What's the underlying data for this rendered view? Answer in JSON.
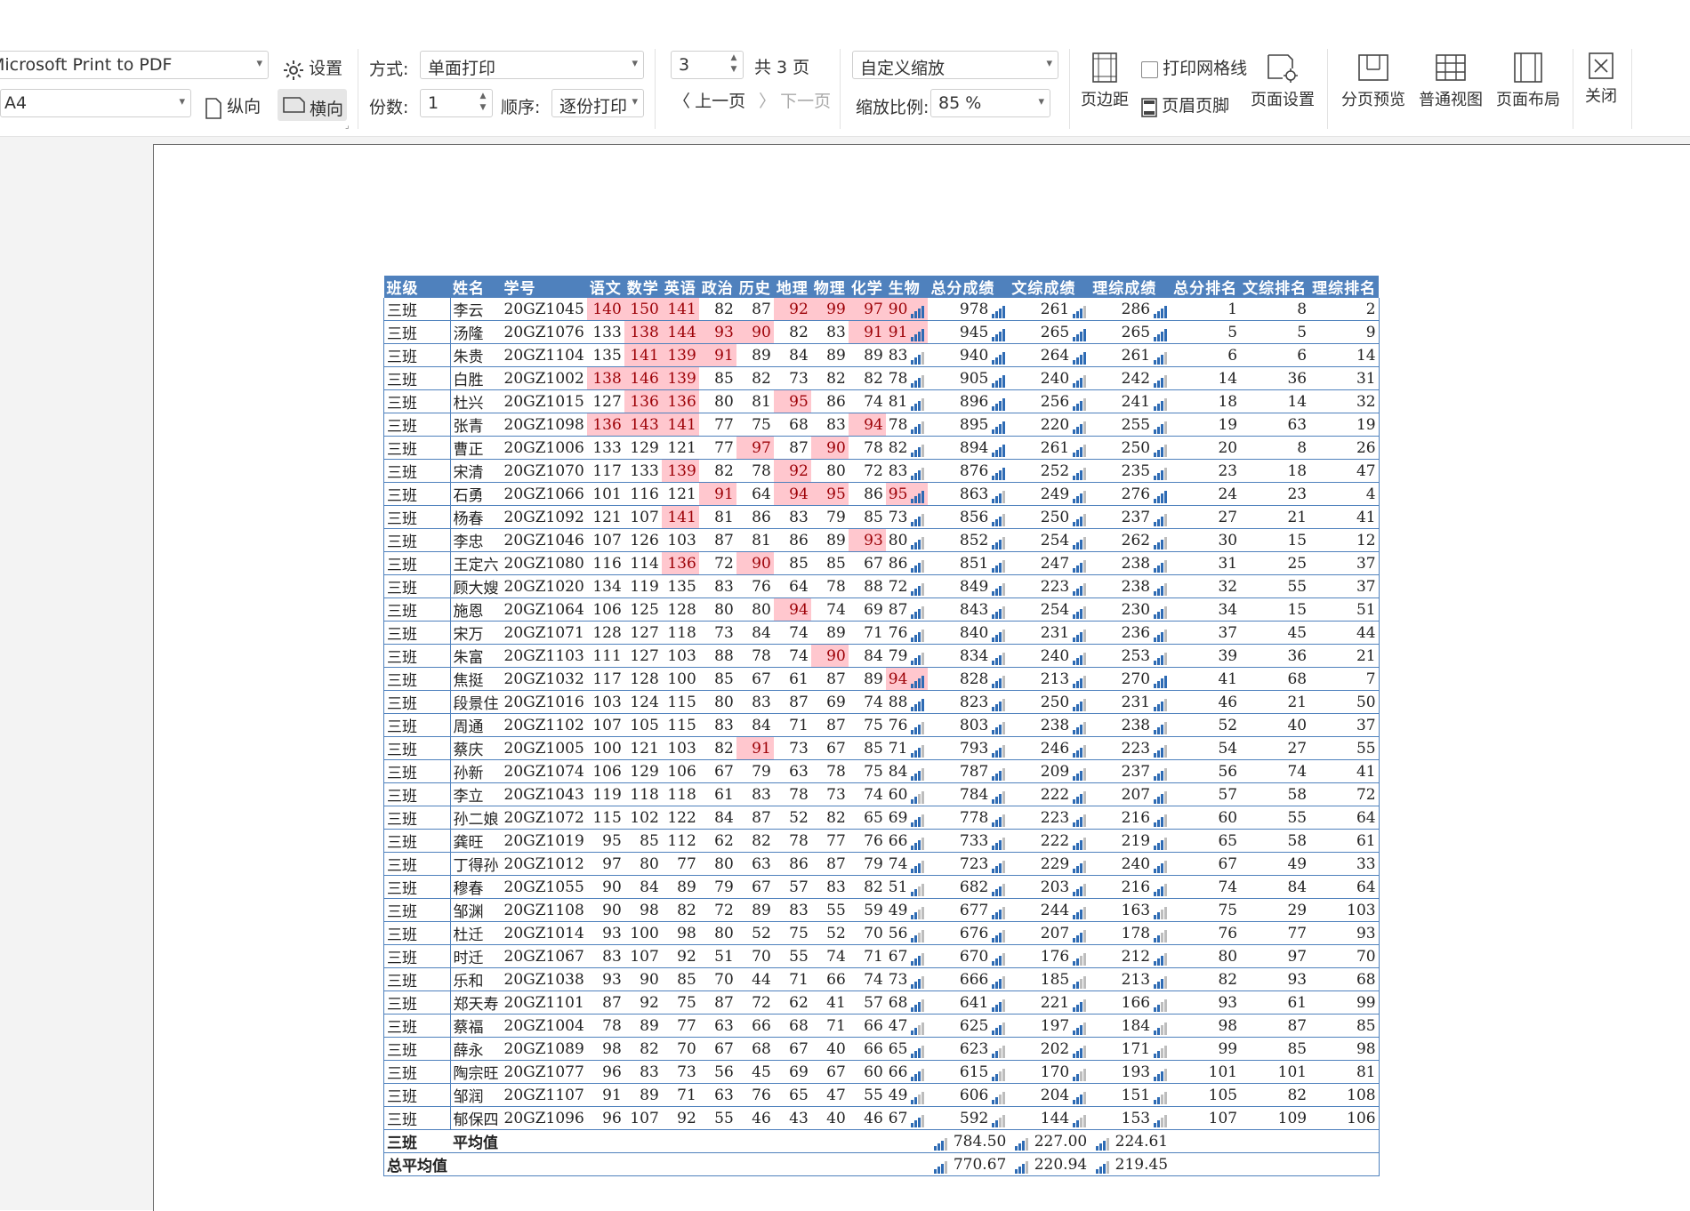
{
  "ribbon": {
    "printer": "Microsoft Print to PDF",
    "settings_label": "设置",
    "paper": "A4",
    "portrait_label": "纵向",
    "landscape_label": "横向",
    "mode_label": "方式:",
    "mode_value": "单面打印",
    "copies_label": "份数:",
    "copies_value": "1",
    "order_label": "顺序:",
    "order_value": "逐份打印",
    "page_value": "3",
    "total_pages": "共 3 页",
    "prev_label": "上一页",
    "next_label": "下一页",
    "zoom_mode": "自定义缩放",
    "zoom_label": "缩放比例:",
    "zoom_value": "85 %",
    "margin_label": "页边距",
    "gridlines_label": "打印网格线",
    "header_footer_label": "页眉页脚",
    "page_setup_label": "页面设置",
    "page_break_label": "分页预览",
    "normal_view_label": "普通视图",
    "page_layout_label": "页面布局",
    "close_label": "关闭"
  },
  "table": {
    "headers": [
      "班级",
      "姓名",
      "学号",
      "语文",
      "数学",
      "英语",
      "政治",
      "历史",
      "地理",
      "物理",
      "化学",
      "生物",
      "总分成绩",
      "文综成绩",
      "理综成绩",
      "总分排名",
      "文综排名",
      "理综排名"
    ],
    "rows": [
      [
        "三班",
        "李云",
        "20GZ1045",
        140,
        150,
        141,
        82,
        87,
        92,
        99,
        97,
        90,
        978,
        261,
        286,
        1,
        8,
        2
      ],
      [
        "三班",
        "汤隆",
        "20GZ1076",
        133,
        138,
        144,
        93,
        90,
        82,
        83,
        91,
        91,
        945,
        265,
        265,
        5,
        5,
        9
      ],
      [
        "三班",
        "朱贵",
        "20GZ1104",
        135,
        141,
        139,
        91,
        89,
        84,
        89,
        89,
        83,
        940,
        264,
        261,
        6,
        6,
        14
      ],
      [
        "三班",
        "白胜",
        "20GZ1002",
        138,
        146,
        139,
        85,
        82,
        73,
        82,
        82,
        78,
        905,
        240,
        242,
        14,
        36,
        31
      ],
      [
        "三班",
        "杜兴",
        "20GZ1015",
        127,
        136,
        136,
        80,
        81,
        95,
        86,
        74,
        81,
        896,
        256,
        241,
        18,
        14,
        32
      ],
      [
        "三班",
        "张青",
        "20GZ1098",
        136,
        143,
        141,
        77,
        75,
        68,
        83,
        94,
        78,
        895,
        220,
        255,
        19,
        63,
        19
      ],
      [
        "三班",
        "曹正",
        "20GZ1006",
        133,
        129,
        121,
        77,
        97,
        87,
        90,
        78,
        82,
        894,
        261,
        250,
        20,
        8,
        26
      ],
      [
        "三班",
        "宋清",
        "20GZ1070",
        117,
        133,
        139,
        82,
        78,
        92,
        80,
        72,
        83,
        876,
        252,
        235,
        23,
        18,
        47
      ],
      [
        "三班",
        "石勇",
        "20GZ1066",
        101,
        116,
        121,
        91,
        64,
        94,
        95,
        86,
        95,
        863,
        249,
        276,
        24,
        23,
        4
      ],
      [
        "三班",
        "杨春",
        "20GZ1092",
        121,
        107,
        141,
        81,
        86,
        83,
        79,
        85,
        73,
        856,
        250,
        237,
        27,
        21,
        41
      ],
      [
        "三班",
        "李忠",
        "20GZ1046",
        107,
        126,
        103,
        87,
        81,
        86,
        89,
        93,
        80,
        852,
        254,
        262,
        30,
        15,
        12
      ],
      [
        "三班",
        "王定六",
        "20GZ1080",
        116,
        114,
        136,
        72,
        90,
        85,
        85,
        67,
        86,
        851,
        247,
        238,
        31,
        25,
        37
      ],
      [
        "三班",
        "顾大嫂",
        "20GZ1020",
        134,
        119,
        135,
        83,
        76,
        64,
        78,
        88,
        72,
        849,
        223,
        238,
        32,
        55,
        37
      ],
      [
        "三班",
        "施恩",
        "20GZ1064",
        106,
        125,
        128,
        80,
        80,
        94,
        74,
        69,
        87,
        843,
        254,
        230,
        34,
        15,
        51
      ],
      [
        "三班",
        "宋万",
        "20GZ1071",
        128,
        127,
        118,
        73,
        84,
        74,
        89,
        71,
        76,
        840,
        231,
        236,
        37,
        45,
        44
      ],
      [
        "三班",
        "朱富",
        "20GZ1103",
        111,
        127,
        103,
        88,
        78,
        74,
        90,
        84,
        79,
        834,
        240,
        253,
        39,
        36,
        21
      ],
      [
        "三班",
        "焦挺",
        "20GZ1032",
        117,
        128,
        100,
        85,
        67,
        61,
        87,
        89,
        94,
        828,
        213,
        270,
        41,
        68,
        7
      ],
      [
        "三班",
        "段景住",
        "20GZ1016",
        103,
        124,
        115,
        80,
        83,
        87,
        69,
        74,
        88,
        823,
        250,
        231,
        46,
        21,
        50
      ],
      [
        "三班",
        "周通",
        "20GZ1102",
        107,
        105,
        115,
        83,
        84,
        71,
        87,
        75,
        76,
        803,
        238,
        238,
        52,
        40,
        37
      ],
      [
        "三班",
        "蔡庆",
        "20GZ1005",
        100,
        121,
        103,
        82,
        91,
        73,
        67,
        85,
        71,
        793,
        246,
        223,
        54,
        27,
        55
      ],
      [
        "三班",
        "孙新",
        "20GZ1074",
        106,
        129,
        106,
        67,
        79,
        63,
        78,
        75,
        84,
        787,
        209,
        237,
        56,
        74,
        41
      ],
      [
        "三班",
        "李立",
        "20GZ1043",
        119,
        118,
        118,
        61,
        83,
        78,
        73,
        74,
        60,
        784,
        222,
        207,
        57,
        58,
        72
      ],
      [
        "三班",
        "孙二娘",
        "20GZ1072",
        115,
        102,
        122,
        84,
        87,
        52,
        82,
        65,
        69,
        778,
        223,
        216,
        60,
        55,
        64
      ],
      [
        "三班",
        "龚旺",
        "20GZ1019",
        95,
        85,
        112,
        62,
        82,
        78,
        77,
        76,
        66,
        733,
        222,
        219,
        65,
        58,
        61
      ],
      [
        "三班",
        "丁得孙",
        "20GZ1012",
        97,
        80,
        77,
        80,
        63,
        86,
        87,
        79,
        74,
        723,
        229,
        240,
        67,
        49,
        33
      ],
      [
        "三班",
        "穆春",
        "20GZ1055",
        90,
        84,
        89,
        79,
        67,
        57,
        83,
        82,
        51,
        682,
        203,
        216,
        74,
        84,
        64
      ],
      [
        "三班",
        "邹渊",
        "20GZ1108",
        90,
        98,
        82,
        72,
        89,
        83,
        55,
        59,
        49,
        677,
        244,
        163,
        75,
        29,
        103
      ],
      [
        "三班",
        "杜迁",
        "20GZ1014",
        93,
        100,
        98,
        80,
        52,
        75,
        52,
        70,
        56,
        676,
        207,
        178,
        76,
        77,
        93
      ],
      [
        "三班",
        "时迁",
        "20GZ1067",
        83,
        107,
        92,
        51,
        70,
        55,
        74,
        71,
        67,
        670,
        176,
        212,
        80,
        97,
        70
      ],
      [
        "三班",
        "乐和",
        "20GZ1038",
        93,
        90,
        85,
        70,
        44,
        71,
        66,
        74,
        73,
        666,
        185,
        213,
        82,
        93,
        68
      ],
      [
        "三班",
        "郑天寿",
        "20GZ1101",
        87,
        92,
        75,
        87,
        72,
        62,
        41,
        57,
        68,
        641,
        221,
        166,
        93,
        61,
        99
      ],
      [
        "三班",
        "蔡福",
        "20GZ1004",
        78,
        89,
        77,
        63,
        66,
        68,
        71,
        66,
        47,
        625,
        197,
        184,
        98,
        87,
        85
      ],
      [
        "三班",
        "薛永",
        "20GZ1089",
        98,
        82,
        70,
        67,
        68,
        67,
        40,
        66,
        65,
        623,
        202,
        171,
        99,
        85,
        98
      ],
      [
        "三班",
        "陶宗旺",
        "20GZ1077",
        96,
        83,
        73,
        56,
        45,
        69,
        67,
        60,
        66,
        615,
        170,
        193,
        101,
        101,
        81
      ],
      [
        "三班",
        "邹润",
        "20GZ1107",
        91,
        89,
        71,
        63,
        76,
        65,
        47,
        55,
        49,
        606,
        204,
        151,
        105,
        82,
        108
      ],
      [
        "三班",
        "郁保四",
        "20GZ1096",
        96,
        107,
        92,
        55,
        46,
        43,
        40,
        46,
        67,
        592,
        144,
        153,
        107,
        109,
        106
      ]
    ],
    "avg_class_label": "三班",
    "avg_label": "平均值",
    "avg_values": [
      "784.50",
      "227.00",
      "224.61"
    ],
    "total_avg_label": "总平均值",
    "total_avg_values": [
      "770.67",
      "220.94",
      "219.45"
    ]
  },
  "highlight_color": "#ffc7ce",
  "header_color": "#4f81bd"
}
